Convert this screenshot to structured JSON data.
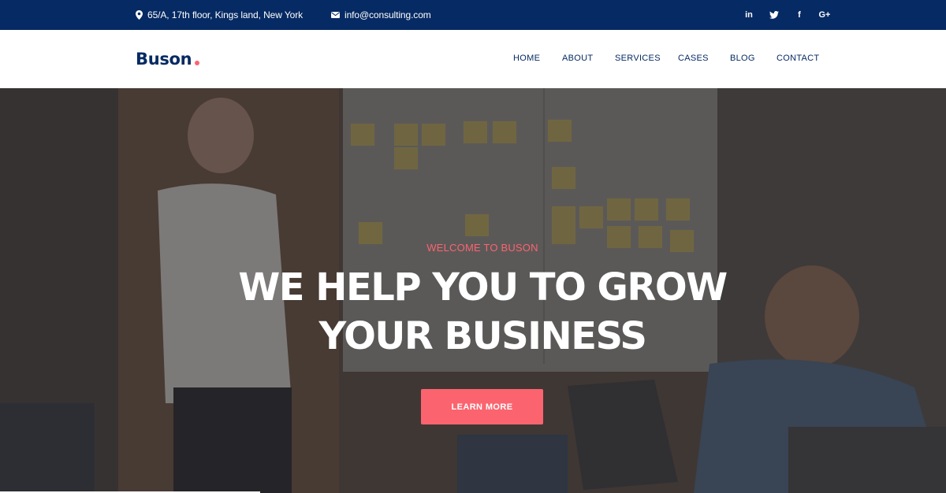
{
  "topbar": {
    "address": "65/A, 17th floor, Kings land, New York",
    "email": "info@consulting.com",
    "socials": [
      {
        "icon": "linkedin-icon",
        "glyph": "in"
      },
      {
        "icon": "twitter-icon",
        "glyph": "t"
      },
      {
        "icon": "facebook-icon",
        "glyph": "f"
      },
      {
        "icon": "google-plus-icon",
        "glyph": "G+"
      }
    ]
  },
  "header": {
    "logo": "Buson",
    "nav": [
      "HOME",
      "ABOUT",
      "SERVICES",
      "CASES",
      "BLOG",
      "CONTACT"
    ]
  },
  "hero": {
    "welcome": "WELCOME TO BUSON",
    "headline_line1": "WE HELP YOU TO GROW",
    "headline_line2": "YOUR BUSINESS",
    "cta": "LEARN MORE"
  },
  "colors": {
    "brand_navy": "#062a63",
    "accent_coral": "#fb646f"
  }
}
